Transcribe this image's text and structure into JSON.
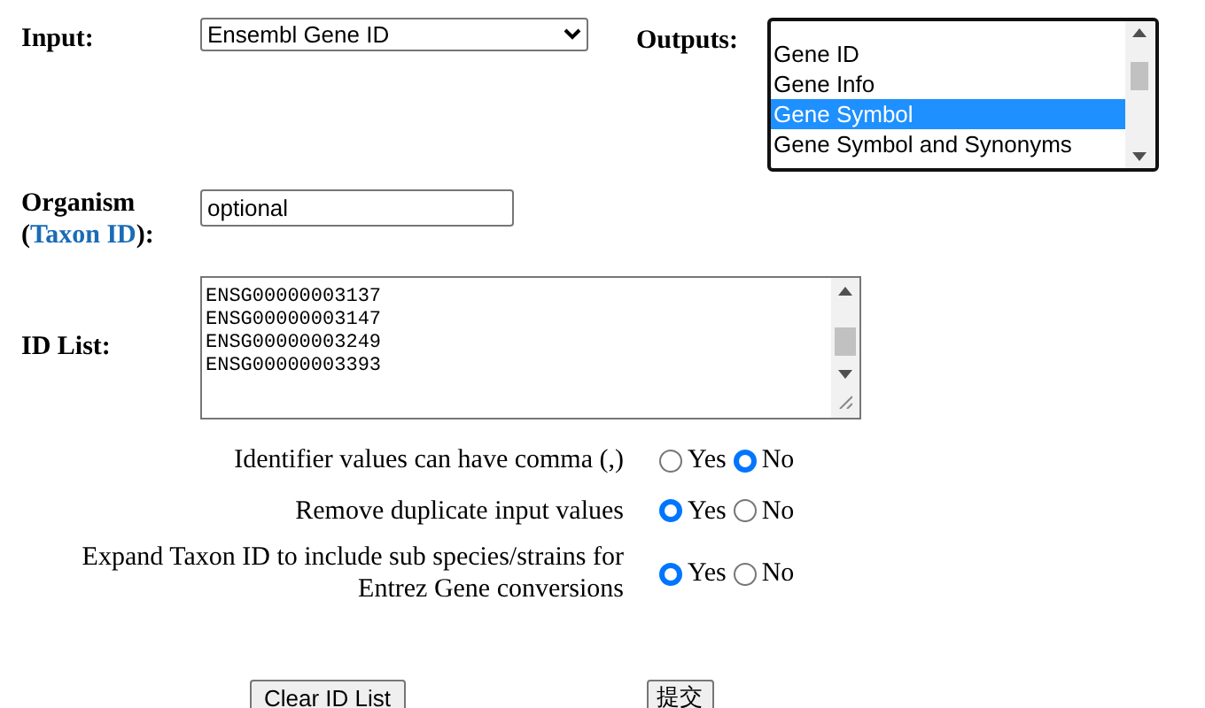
{
  "input": {
    "label": "Input:",
    "value": "Ensembl Gene ID"
  },
  "outputs": {
    "label": "Outputs:",
    "options": [
      {
        "label": "Gene ID",
        "selected": false
      },
      {
        "label": "Gene Info",
        "selected": false
      },
      {
        "label": "Gene Symbol",
        "selected": true
      },
      {
        "label": "Gene Symbol and Synonyms",
        "selected": false
      }
    ]
  },
  "organism": {
    "label": "Organism",
    "link_open": "(",
    "link": "Taxon ID",
    "link_close": "):",
    "value": "optional"
  },
  "id_list": {
    "label": "ID List:",
    "lines": [
      "ENSG00000003137",
      "ENSG00000003147",
      "ENSG00000003249",
      "ENSG00000003393"
    ]
  },
  "settings": [
    {
      "label": "Identifier values can have comma (,)",
      "options": [
        {
          "label": "Yes",
          "selected": false
        },
        {
          "label": "No",
          "selected": true
        }
      ]
    },
    {
      "label": "Remove duplicate input values",
      "options": [
        {
          "label": "Yes",
          "selected": true
        },
        {
          "label": "No",
          "selected": false
        }
      ]
    },
    {
      "label": "Expand Taxon ID to include sub species/strains for Entrez Gene conversions",
      "options": [
        {
          "label": "Yes",
          "selected": true
        },
        {
          "label": "No",
          "selected": false
        }
      ]
    }
  ],
  "buttons": [
    "Clear ID List",
    "提交"
  ]
}
